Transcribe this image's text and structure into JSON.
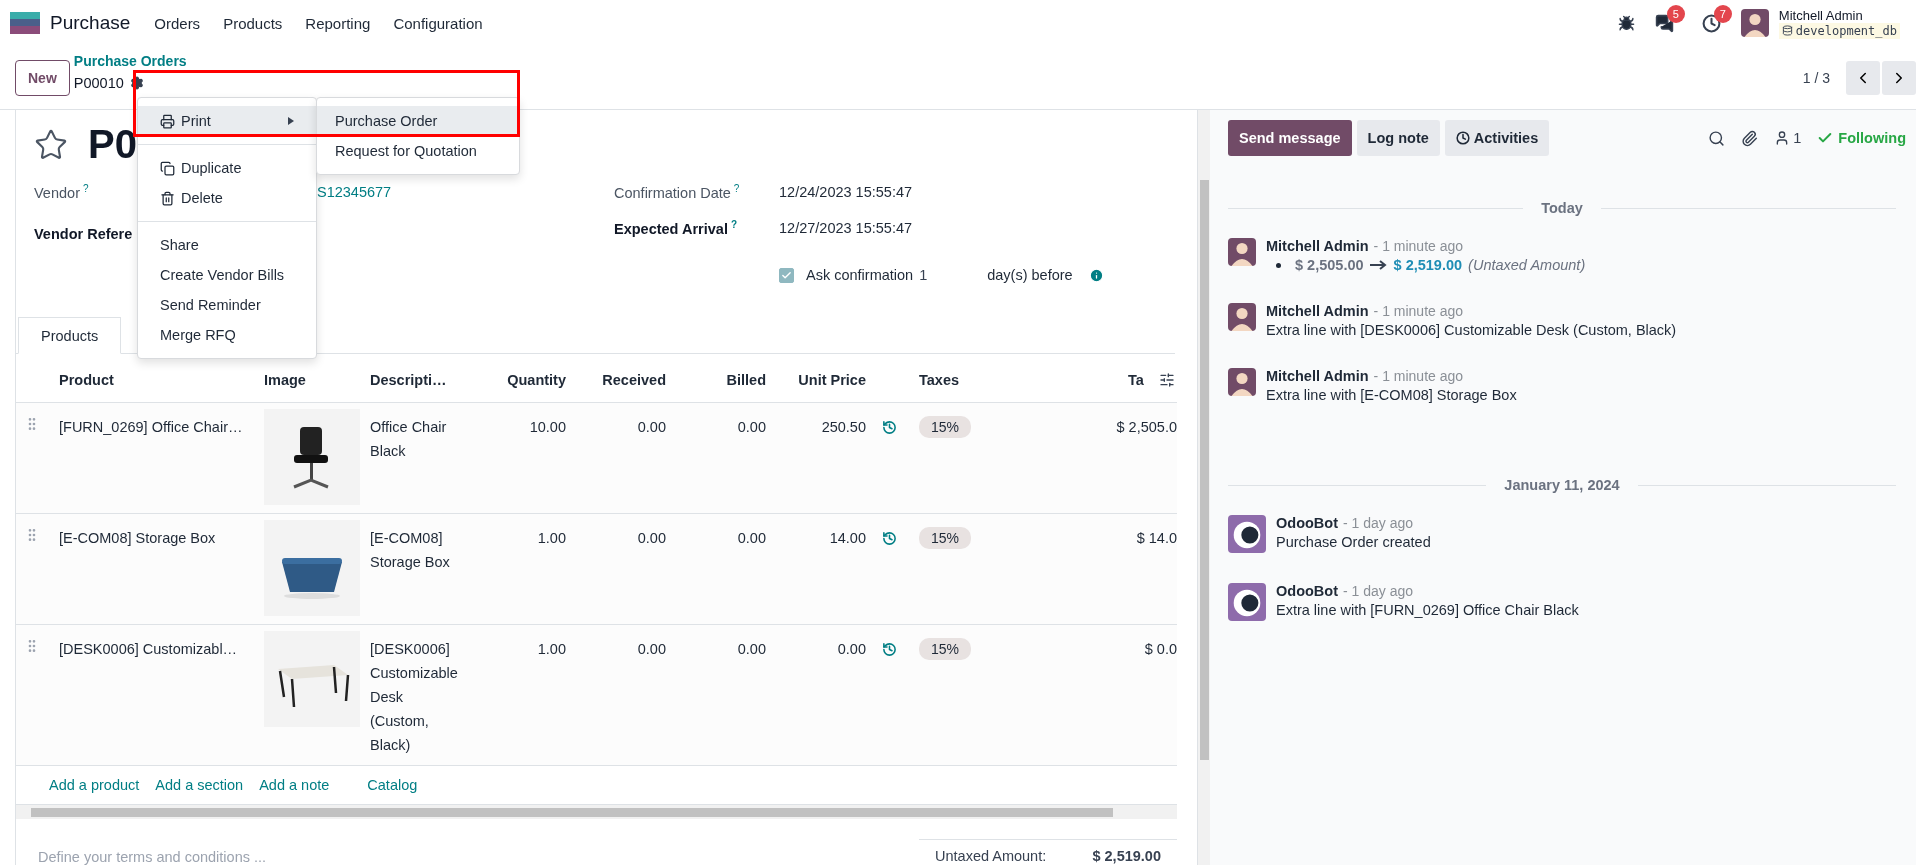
{
  "navbar": {
    "app_name": "Purchase",
    "menus": [
      "Orders",
      "Products",
      "Reporting",
      "Configuration"
    ],
    "messages_badge": "5",
    "activities_badge": "7",
    "user": {
      "name": "Mitchell Admin",
      "database": "development_db"
    }
  },
  "control_panel": {
    "new_button": "New",
    "breadcrumb": "Purchase Orders",
    "record": "P00010",
    "pager": "1 / 3"
  },
  "actions_menu": {
    "groups": [
      [
        {
          "label": "Print",
          "kind": "print",
          "selected": true,
          "has_submenu": true
        }
      ],
      [
        {
          "label": "Duplicate",
          "kind": "duplicate",
          "selected": false,
          "has_submenu": false
        },
        {
          "label": "Delete",
          "kind": "delete",
          "selected": false,
          "has_submenu": false
        }
      ],
      [
        {
          "label": "Share",
          "kind": "plain",
          "selected": false,
          "has_submenu": false
        },
        {
          "label": "Create Vendor Bills",
          "kind": "plain",
          "selected": false,
          "has_submenu": false
        },
        {
          "label": "Send Reminder",
          "kind": "plain",
          "selected": false,
          "has_submenu": false
        },
        {
          "label": "Merge RFQ",
          "kind": "plain",
          "selected": false,
          "has_submenu": false
        }
      ]
    ],
    "submenu": [
      {
        "label": "Purchase Order",
        "selected": true
      },
      {
        "label": "Request for Quotation",
        "selected": false
      }
    ]
  },
  "form": {
    "title": "P0",
    "starred": false,
    "left_fields": [
      {
        "label": "Vendor",
        "help": "?",
        "required": false,
        "value": "S12345677"
      },
      {
        "label": "Vendor Refere",
        "required": true
      }
    ],
    "right_fields": [
      {
        "label": "Confirmation Date",
        "help": "?",
        "required": false,
        "value": "12/24/2023 15:55:47"
      },
      {
        "label": "Expected Arrival",
        "help": "?",
        "required": true,
        "value": "12/27/2023 15:55:47"
      }
    ],
    "ask_confirmation": {
      "label": "Ask confirmation",
      "checked": true,
      "days": "1",
      "suffix": "day(s) before"
    },
    "tabs": [
      {
        "label": "Products",
        "selected": true
      }
    ],
    "table": {
      "columns": [
        "Product",
        "Image",
        "Descripti…",
        "Quantity",
        "Received",
        "Billed",
        "Unit Price",
        "Taxes",
        "Ta"
      ],
      "rows": [
        {
          "product": "[FURN_0269] Office Chair…",
          "description": "Office Chair Black",
          "quantity": "10.00",
          "received": "0.00",
          "billed": "0.00",
          "unit_price": "250.50",
          "taxes": "15%",
          "total": "$ 2,505.0"
        },
        {
          "product": "[E-COM08] Storage Box",
          "description": "[E-COM08] Storage Box",
          "quantity": "1.00",
          "received": "0.00",
          "billed": "0.00",
          "unit_price": "14.00",
          "taxes": "15%",
          "total": "$ 14.0"
        },
        {
          "product": "[DESK0006] Customizabl…",
          "description": "[DESK0006] Customizable Desk (Custom, Black)",
          "quantity": "1.00",
          "received": "0.00",
          "billed": "0.00",
          "unit_price": "0.00",
          "taxes": "15%",
          "total": "$ 0.0"
        }
      ],
      "footer_links": [
        "Add a product",
        "Add a section",
        "Add a note",
        "Catalog"
      ]
    },
    "terms_placeholder": "Define your terms and conditions ...",
    "totals": [
      {
        "label": "Untaxed Amount:",
        "value": "$ 2,519.00"
      }
    ]
  },
  "chatter": {
    "buttons": [
      {
        "label": "Send message",
        "kind": "primary"
      },
      {
        "label": "Log note",
        "kind": "secondary"
      },
      {
        "label": "Activities",
        "kind": "activities"
      }
    ],
    "followers": "1",
    "following": "Following",
    "feed": [
      {
        "kind": "separator",
        "label": "Today"
      },
      {
        "kind": "user",
        "author": "Mitchell Admin",
        "time": "- 1 minute ago",
        "tracking": {
          "old_value": "$ 2,505.00",
          "new_value": "$ 2,519.00",
          "field": "(Untaxed Amount)"
        }
      },
      {
        "kind": "user",
        "author": "Mitchell Admin",
        "time": "- 1 minute ago",
        "body": "Extra line with [DESK0006] Customizable Desk (Custom, Black)"
      },
      {
        "kind": "user",
        "author": "Mitchell Admin",
        "time": "- 1 minute ago",
        "body": "Extra line with [E-COM08] Storage Box"
      },
      {
        "kind": "separator",
        "label": "January 11, 2024"
      },
      {
        "kind": "bot",
        "author": "OdooBot",
        "time": "- 1 day ago",
        "body": "Purchase Order created"
      },
      {
        "kind": "bot",
        "author": "OdooBot",
        "time": "- 1 day ago",
        "body": "Extra line with [FURN_0269] Office Chair Black"
      }
    ]
  }
}
